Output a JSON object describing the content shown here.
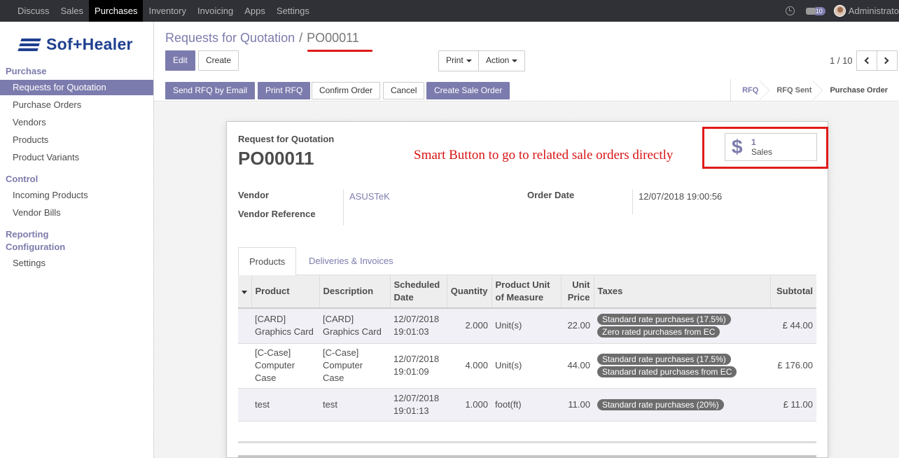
{
  "navbar": {
    "items": [
      "Discuss",
      "Sales",
      "Purchases",
      "Inventory",
      "Invoicing",
      "Apps",
      "Settings"
    ],
    "active": "Purchases",
    "badge": "10",
    "user": "Administrato"
  },
  "sidebar": {
    "logo_text": "Sof+Healer",
    "sections": {
      "purchase": "Purchase",
      "control": "Control",
      "reporting": "Reporting",
      "configuration": "Configuration"
    },
    "items": {
      "rfq": "Requests for Quotation",
      "purchase_orders": "Purchase Orders",
      "vendors": "Vendors",
      "products": "Products",
      "product_variants": "Product Variants",
      "incoming_products": "Incoming Products",
      "vendor_bills": "Vendor Bills",
      "settings": "Settings"
    }
  },
  "breadcrumb": {
    "parent": "Requests for Quotation",
    "sep": "/",
    "current": "PO00011"
  },
  "toolbar": {
    "edit": "Edit",
    "create": "Create",
    "print": "Print",
    "action": "Action",
    "pager": "1 / 10"
  },
  "statusbar": {
    "send_rfq": "Send RFQ by Email",
    "print_rfq": "Print RFQ",
    "confirm": "Confirm Order",
    "cancel": "Cancel",
    "create_sale": "Create Sale Order",
    "steps": [
      "RFQ",
      "RFQ Sent",
      "Purchase Order"
    ]
  },
  "form": {
    "label": "Request for Quotation",
    "title": "PO00011",
    "annotation": "Smart Button to go to related sale orders directly",
    "smart_button": {
      "value": "1",
      "label": "Sales"
    },
    "vendor_label": "Vendor",
    "vendor_value": "ASUSTeK",
    "vendor_ref_label": "Vendor Reference",
    "order_date_label": "Order Date",
    "order_date_value": "12/07/2018 19:00:56"
  },
  "tabs": [
    "Products",
    "Deliveries & Invoices"
  ],
  "table": {
    "headers": {
      "product": "Product",
      "description": "Description",
      "sched1": "Scheduled",
      "sched2": "Date",
      "quantity": "Quantity",
      "uom1": "Product Unit",
      "uom2": "of Measure",
      "price1": "Unit",
      "price2": "Price",
      "taxes": "Taxes",
      "subtotal": "Subtotal"
    },
    "rows": [
      {
        "product": [
          "[CARD]",
          "Graphics Card"
        ],
        "description": [
          "[CARD]",
          "Graphics Card"
        ],
        "date": [
          "12/07/2018",
          "19:01:03"
        ],
        "qty": "2.000",
        "uom": "Unit(s)",
        "price": "22.00",
        "taxes": [
          "Standard rate purchases (17.5%)",
          "Zero rated purchases from EC"
        ],
        "subtotal": "£ 44.00"
      },
      {
        "product": [
          "[C-Case]",
          "Computer",
          "Case"
        ],
        "description": [
          "[C-Case]",
          "Computer",
          "Case"
        ],
        "date": [
          "12/07/2018",
          "19:01:09"
        ],
        "qty": "4.000",
        "uom": "Unit(s)",
        "price": "44.00",
        "taxes": [
          "Standard rate purchases (17.5%)",
          "Standard rated purchases from EC"
        ],
        "subtotal": "£ 176.00"
      },
      {
        "product": [
          "test"
        ],
        "description": [
          "test"
        ],
        "date": [
          "12/07/2018",
          "19:01:13"
        ],
        "qty": "1.000",
        "uom": "foot(ft)",
        "price": "11.00",
        "taxes": [
          "Standard rate purchases (20%)"
        ],
        "subtotal": "£ 11.00"
      }
    ]
  },
  "colors": {
    "accent": "#7c7bad",
    "highlight": "#e01a1a",
    "navbar": "#2f3136"
  }
}
